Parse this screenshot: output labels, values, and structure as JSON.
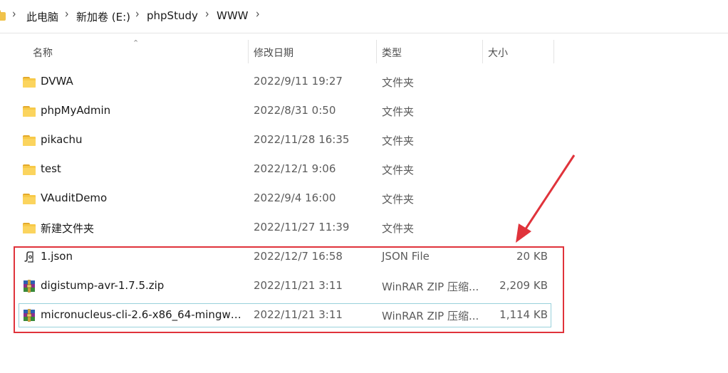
{
  "breadcrumb": {
    "items": [
      "此电脑",
      "新加卷 (E:)",
      "phpStudy",
      "WWW"
    ],
    "separator": "›"
  },
  "columns": {
    "name": "名称",
    "modified": "修改日期",
    "type": "类型",
    "size": "大小"
  },
  "files": [
    {
      "name": "DVWA",
      "modified": "2022/9/11 19:27",
      "type": "文件夹",
      "size": "",
      "icon": "folder-icon"
    },
    {
      "name": "phpMyAdmin",
      "modified": "2022/8/31 0:50",
      "type": "文件夹",
      "size": "",
      "icon": "folder-icon"
    },
    {
      "name": "pikachu",
      "modified": "2022/11/28 16:35",
      "type": "文件夹",
      "size": "",
      "icon": "folder-icon"
    },
    {
      "name": "test",
      "modified": "2022/12/1 9:06",
      "type": "文件夹",
      "size": "",
      "icon": "folder-icon"
    },
    {
      "name": "VAuditDemo",
      "modified": "2022/9/4 16:00",
      "type": "文件夹",
      "size": "",
      "icon": "folder-icon"
    },
    {
      "name": "新建文件夹",
      "modified": "2022/11/27 11:39",
      "type": "文件夹",
      "size": "",
      "icon": "folder-icon"
    },
    {
      "name": "1.json",
      "modified": "2022/12/7 16:58",
      "type": "JSON File",
      "size": "20 KB",
      "icon": "json-file-icon"
    },
    {
      "name": "digistump-avr-1.7.5.zip",
      "modified": "2022/11/21 3:11",
      "type": "WinRAR ZIP 压缩...",
      "size": "2,209 KB",
      "icon": "winrar-zip-icon"
    },
    {
      "name": "micronucleus-cli-2.6-x86_64-mingw3...",
      "modified": "2022/11/21 3:11",
      "type": "WinRAR ZIP 压缩...",
      "size": "1,114 KB",
      "icon": "winrar-zip-icon",
      "selected": true
    }
  ],
  "annotation": {
    "color": "#e0333b",
    "shape": "rectangle-with-arrow"
  },
  "colors": {
    "folder": "#f7c948",
    "selection_border": "#99d1db",
    "annotation": "#e0333b"
  }
}
